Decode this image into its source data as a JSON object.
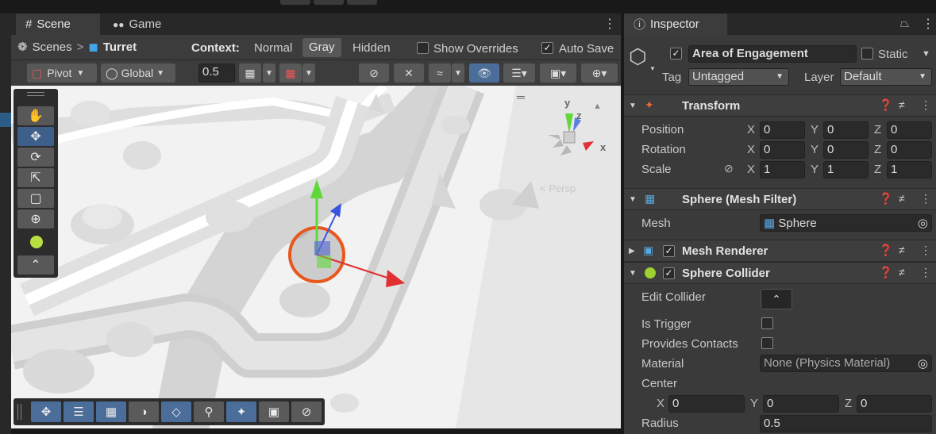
{
  "tabs": {
    "scene": "Scene",
    "game": "Game",
    "inspector": "Inspector"
  },
  "breadcrumb": {
    "root": "Scenes",
    "separator": ">",
    "prefab": "Turret"
  },
  "context": {
    "label": "Context:",
    "normal": "Normal",
    "gray": "Gray",
    "hidden": "Hidden",
    "show_overrides": "Show Overrides",
    "auto_save": "Auto Save"
  },
  "toolbar": {
    "pivot": "Pivot",
    "global": "Global",
    "snap_value": "0.5"
  },
  "gizmo": {
    "y": "y",
    "z": "z",
    "x": "x",
    "persp": "< Persp"
  },
  "inspector": {
    "object_name": "Area of Engagement",
    "static_label": "Static",
    "tag_label": "Tag",
    "tag_value": "Untagged",
    "layer_label": "Layer",
    "layer_value": "Default"
  },
  "transform": {
    "title": "Transform",
    "position": {
      "label": "Position",
      "x": "0",
      "y": "0",
      "z": "0"
    },
    "rotation": {
      "label": "Rotation",
      "x": "0",
      "y": "0",
      "z": "0"
    },
    "scale": {
      "label": "Scale",
      "x": "1",
      "y": "1",
      "z": "1"
    }
  },
  "mesh_filter": {
    "title": "Sphere (Mesh Filter)",
    "mesh_label": "Mesh",
    "mesh_value": "Sphere"
  },
  "mesh_renderer": {
    "title": "Mesh Renderer"
  },
  "sphere_collider": {
    "title": "Sphere Collider",
    "edit_collider": "Edit Collider",
    "is_trigger": "Is Trigger",
    "provides_contacts": "Provides Contacts",
    "material_label": "Material",
    "material_value": "None (Physics Material)",
    "center_label": "Center",
    "center": {
      "x": "0",
      "y": "0",
      "z": "0"
    },
    "radius_label": "Radius",
    "radius_value": "0.5"
  },
  "axis_letters": {
    "x": "X",
    "y": "Y",
    "z": "Z"
  },
  "colors": {
    "selected": "#4b6d9a",
    "accent_orange": "#e8571c",
    "gizmo_green": "#5fd83a",
    "gizmo_red": "#e03030",
    "gizmo_blue": "#3a55e0"
  }
}
